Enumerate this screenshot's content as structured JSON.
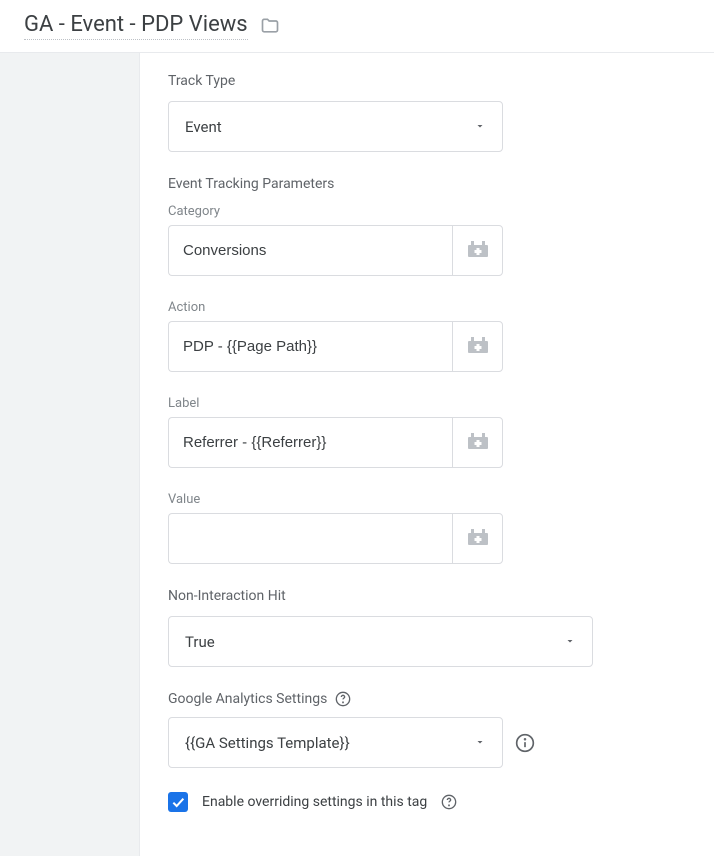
{
  "header": {
    "title": "GA - Event - PDP Views"
  },
  "trackType": {
    "label": "Track Type",
    "value": "Event"
  },
  "eventParams": {
    "sectionLabel": "Event Tracking Parameters",
    "category": {
      "label": "Category",
      "value": "Conversions"
    },
    "action": {
      "label": "Action",
      "value": "PDP - {{Page Path}}"
    },
    "eventLabel": {
      "label": "Label",
      "value": "Referrer - {{Referrer}}"
    },
    "eventValue": {
      "label": "Value",
      "value": ""
    }
  },
  "nonInteraction": {
    "label": "Non-Interaction Hit",
    "value": "True"
  },
  "gaSettings": {
    "label": "Google Analytics Settings",
    "value": "{{GA Settings Template}}"
  },
  "override": {
    "label": "Enable overriding settings in this tag",
    "checked": true
  }
}
